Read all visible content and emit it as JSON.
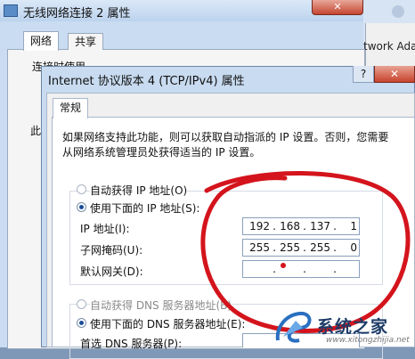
{
  "back_window": {
    "title": "无线网络连接 2 属性",
    "tabs": [
      "网络",
      "共享"
    ],
    "behind_label_1": "连接时使用",
    "behind_label_2": "此",
    "behind_text_right": "twork Ada",
    "close_label": "✕"
  },
  "dialog": {
    "title": "Internet 协议版本 4 (TCP/IPv4) 属性",
    "help_label": "?",
    "close_label": "✕",
    "tab": "常规",
    "description": "如果网络支持此功能，则可以获取自动指派的 IP 设置。否则，您需要从网络系统管理员处获得适当的 IP 设置。",
    "ip_auto_label": "自动获得 IP 地址(O)",
    "ip_manual_label": "使用下面的 IP 地址(S):",
    "ip_address_label": "IP 地址(I):",
    "subnet_label": "子网掩码(U):",
    "gateway_label": "默认网关(D):",
    "ip_address": [
      "192",
      "168",
      "137",
      "1"
    ],
    "subnet_mask": [
      "255",
      "255",
      "255",
      "0"
    ],
    "gateway": [
      "",
      "",
      "",
      ""
    ],
    "dns_auto_label": "自动获得 DNS 服务器地址(B)",
    "dns_manual_label": "使用下面的 DNS 服务器地址(E):",
    "dns_preferred_label": "首选 DNS 服务器(P):"
  },
  "watermark": {
    "text": "系统之家",
    "url": "www.xitongzhijia.net"
  },
  "colors": {
    "annotation_circle": "#d4141c",
    "title_bar": "#c9dcf1",
    "close_button": "#c7432c"
  }
}
